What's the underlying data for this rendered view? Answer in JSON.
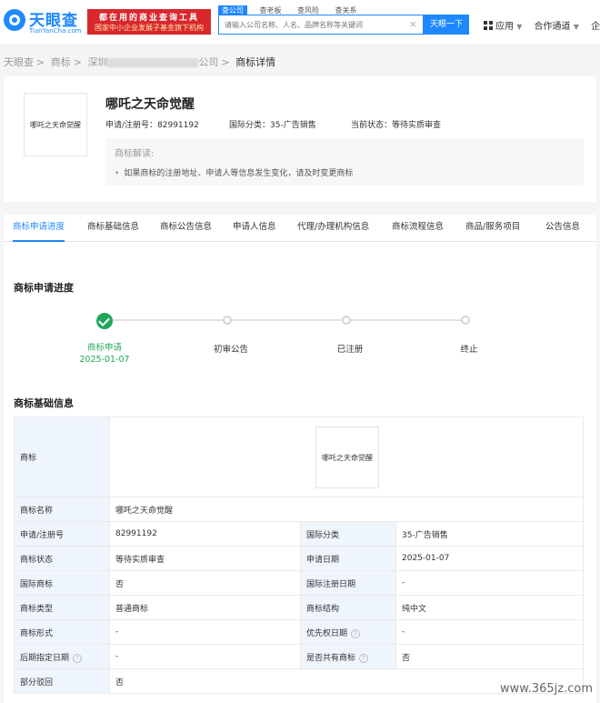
{
  "header": {
    "logo_text": "天眼查",
    "logo_sub": "TianYanCha.com",
    "promo_line1": "都在用的商业查询工具",
    "promo_line2": "国家中小企业发展子基金旗下机构",
    "search_tabs": [
      "查公司",
      "查老板",
      "查风险",
      "查关系"
    ],
    "search_placeholder": "请输入公司名称、人名、品牌名称等关键词",
    "search_button": "天眼一下",
    "nav": [
      "应用",
      "合作通道",
      "企"
    ]
  },
  "breadcrumb": {
    "items": [
      "天眼查",
      "商标",
      "深圳",
      "公司",
      "商标详情"
    ]
  },
  "summary": {
    "thumb_text": "哪吒之天命觉醒",
    "title": "哪吒之天命觉醒",
    "reg_no": "申请/注册号：82991192",
    "intl_class": "国际分类：35-广告销售",
    "status": "当前状态：等待实质审查",
    "explain_title": "商标解读:",
    "explain_item": "如果商标的注册地址、申请人等信息发生变化，请及时变更商标"
  },
  "tabs": [
    "商标申请进度",
    "商标基础信息",
    "商标公告信息",
    "申请人信息",
    "代理/办理机构信息",
    "商标流程信息",
    "商品/服务项目",
    "公告信息"
  ],
  "progress": {
    "title": "商标申请进度",
    "steps": [
      {
        "label": "商标申请",
        "date": "2025-01-07"
      },
      {
        "label": "初审公告"
      },
      {
        "label": "已注册"
      },
      {
        "label": "终止"
      }
    ]
  },
  "basic": {
    "title": "商标基础信息",
    "trademark_label": "商标",
    "trademark_image_text": "哪吒之天命觉醒",
    "rows": [
      {
        "l1": "商标名称",
        "v1": "哪吒之天命觉醒"
      },
      {
        "l1": "申请/注册号",
        "v1": "82991192",
        "l2": "国际分类",
        "v2": "35-广告销售"
      },
      {
        "l1": "商标状态",
        "v1": "等待实质审查",
        "l2": "申请日期",
        "v2": "2025-01-07"
      },
      {
        "l1": "国际商标",
        "v1": "否",
        "l2": "国际注册日期",
        "v2": "-"
      },
      {
        "l1": "商标类型",
        "v1": "普通商标",
        "l2": "商标结构",
        "v2": "纯中文"
      },
      {
        "l1": "商标形式",
        "v1": "-",
        "l2": "优先权日期",
        "v2": "-"
      },
      {
        "l1": "后期指定日期",
        "v1": "-",
        "l2": "是否共有商标",
        "v2": "否"
      },
      {
        "l1": "部分驳回",
        "v1": "否"
      }
    ]
  },
  "watermark": "www.365jz.com"
}
